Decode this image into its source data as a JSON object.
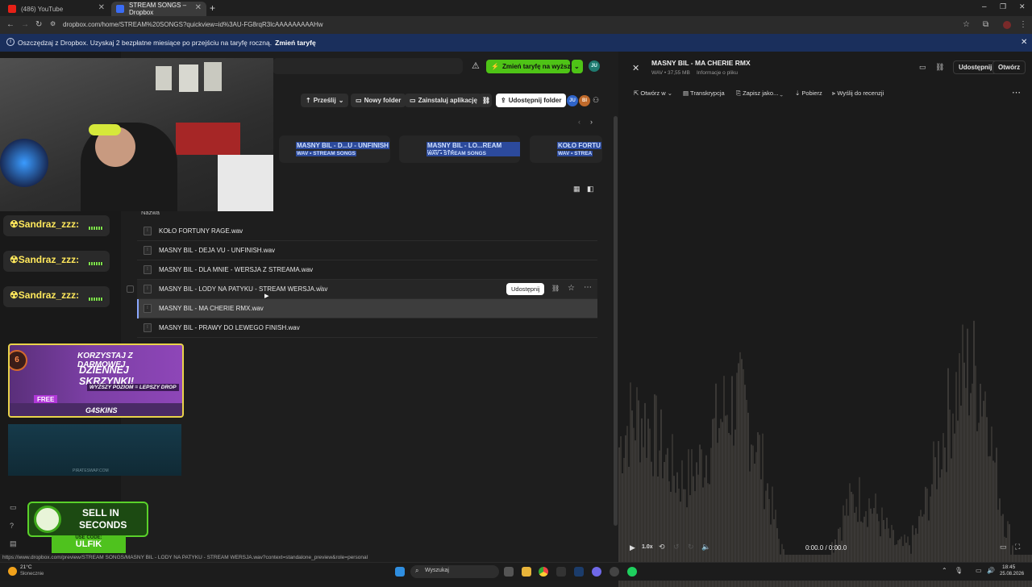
{
  "browser": {
    "tabs": [
      {
        "label": "(486) YouTube",
        "active": false
      },
      {
        "label": "STREAM SONGS – Dropbox",
        "active": true
      }
    ],
    "new_tab": "+",
    "url": "dropbox.com/home/STREAM%20SONGS?quickview=id%3AU-FG8rqR3lcAAAAAAAAAHw",
    "window_controls": [
      "–",
      "❐",
      "✕"
    ]
  },
  "banner": {
    "text": "Oszczędzaj z Dropbox. Uzyskaj 2 bezpłatne miesiące po przejściu na taryfę roczną.",
    "link": "Zmień taryfę",
    "close": "✕"
  },
  "header": {
    "upgrade_button": "Zmień taryfę na wyższą",
    "user_initials": "JU"
  },
  "toolbar": {
    "send": "Prześlij",
    "new_folder": "Nowy folder",
    "install_app": "Zainstaluj aplikację",
    "share_folder": "Udostępnij folder",
    "members": [
      "JU",
      "BI"
    ]
  },
  "suggested": [
    {
      "title": "MASNY BIL - D...U - UNFINISH",
      "meta": "WAV • STREAM SONGS"
    },
    {
      "title": "MASNY BIL - LO...REAM WERSJA",
      "meta": "WAV • STREAM SONGS"
    },
    {
      "title": "KOŁO FORTU",
      "meta": "WAV • STREA"
    }
  ],
  "file_list": {
    "column_name": "Nazwa",
    "files": [
      {
        "name": "KOŁO FORTUNY RAGE.wav"
      },
      {
        "name": "MASNY BIL - DEJA VU - UNFINISH.wav"
      },
      {
        "name": "MASNY BIL - DLA MNIE - WERSJA Z STREAMA.wav"
      },
      {
        "name": "MASNY BIL - LODY NA PATYKU - STREAM WERSJA.wav",
        "state": "hover"
      },
      {
        "name": "MASNY BIL - MA CHERIE RMX.wav",
        "state": "selected"
      },
      {
        "name": "MASNY BIL - PRAWY DO LEWEGO FINISH.wav"
      }
    ],
    "row_share": "Udostępnij"
  },
  "preview": {
    "title": "MASNY BIL - MA CHERIE RMX",
    "meta": "WAV • 37,55 MB",
    "info_link": "Informacje o pliku",
    "share": "Udostępnij",
    "open": "Otwórz",
    "actions": [
      "Otwórz w",
      "Transkrypcja",
      "Zapisz jako...",
      "Pobierz",
      "Wyślij do recenzji"
    ],
    "player": {
      "speed": "1.0x",
      "time": "0:00.0 / 0:00.0"
    }
  },
  "overlay": {
    "chat_user": "Sandraz_zzz:",
    "promo_line1": "KORZYSTAJ Z DARMOWEJ",
    "promo_line2": "DZIENNEJ SKRZYNKI!",
    "promo_line3": "WYŻSZY POZIOM = LEPSZY DROP",
    "promo_free": "FREE",
    "promo_brand": "G4SKINS",
    "promo_badge": "6",
    "sell_line1": "SELL IN",
    "sell_line2": "SECONDS",
    "sell_code_label": "USE CODE:",
    "sell_code": "ULFIK",
    "site": "PIRATESWAP.COM"
  },
  "status_url": "https://www.dropbox.com/preview/STREAM SONGS/MASNY BIL - LODY NA PATYKU - STREAM WERSJA.wav?context=standalone_preview&role=personal",
  "taskbar": {
    "weather_temp": "21°C",
    "weather_desc": "Słonecznie",
    "search": "Wyszukaj",
    "time": "18:45",
    "date": "25.08.2026"
  },
  "colors": {
    "accent_green": "#4ec316",
    "banner_blue": "#1a2f5c",
    "selection_blue": "#2c4a9c"
  }
}
